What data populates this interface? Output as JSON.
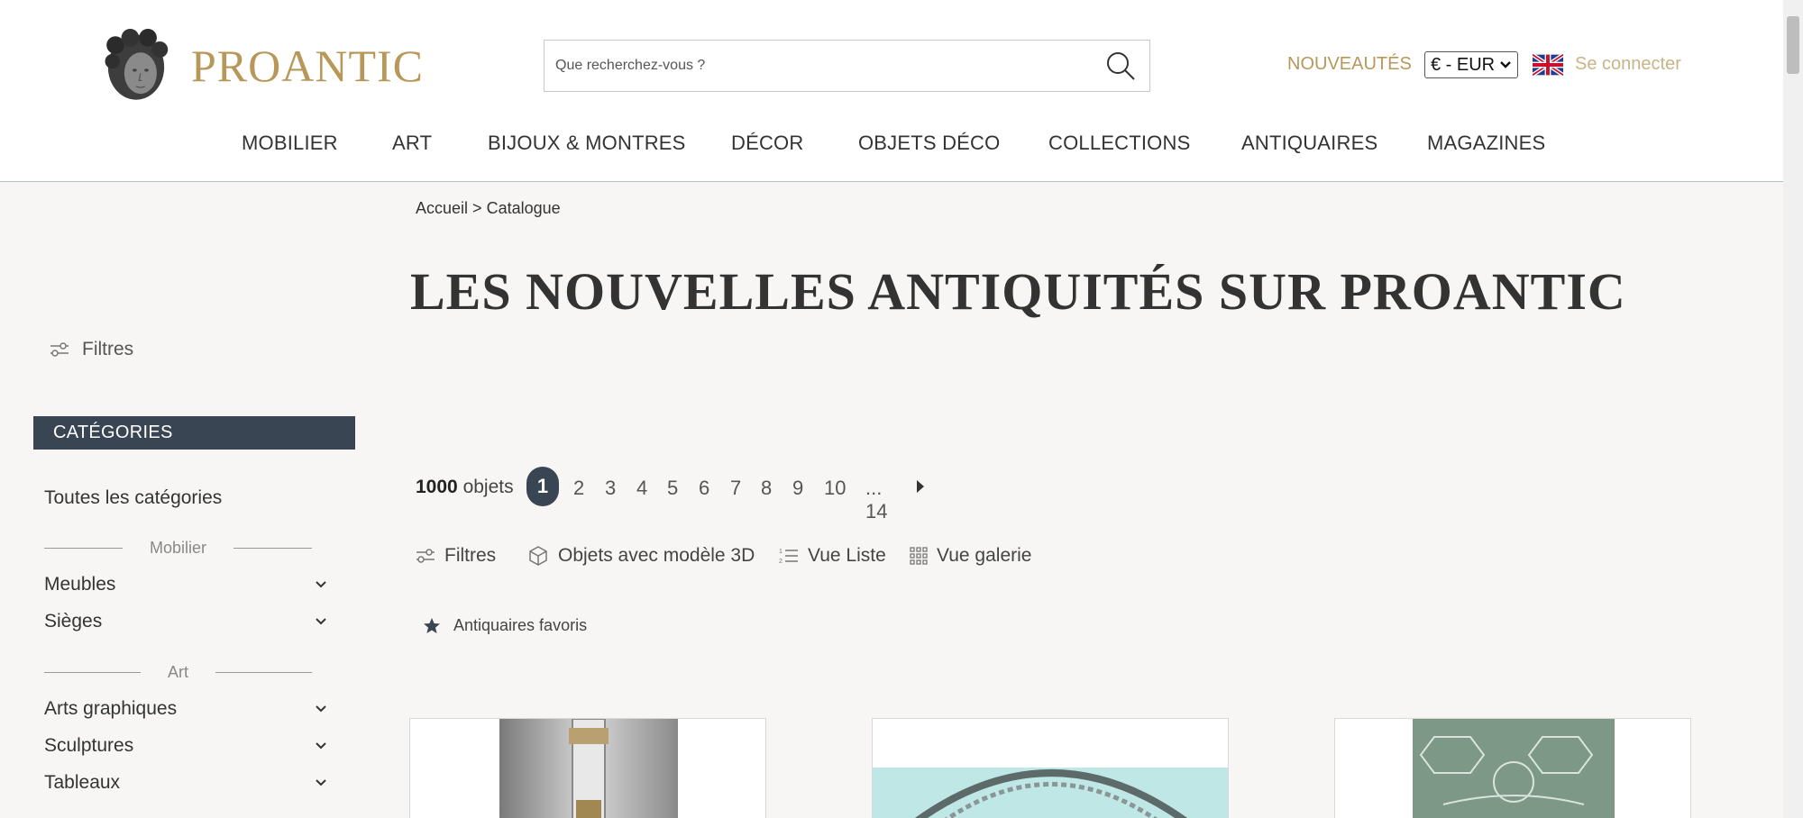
{
  "header": {
    "logo_text": "PROANTIC",
    "search_placeholder": "Que recherchez-vous ?",
    "nouveautes": "NOUVEAUTÉS",
    "currency": "€ - EUR",
    "login": "Se connecter"
  },
  "nav": [
    "MOBILIER",
    "ART",
    "BIJOUX & MONTRES",
    "DÉCOR",
    "OBJETS DÉCO",
    "COLLECTIONS",
    "ANTIQUAIRES",
    "MAGAZINES"
  ],
  "sidebar": {
    "filters": "Filtres",
    "categories_title": "CATÉGORIES",
    "all": "Toutes les catégories",
    "groups": [
      {
        "label": "Mobilier",
        "items": [
          "Meubles",
          "Sièges"
        ]
      },
      {
        "label": "Art",
        "items": [
          "Arts graphiques",
          "Sculptures",
          "Tableaux"
        ]
      }
    ]
  },
  "main": {
    "breadcrumb": {
      "home": "Accueil",
      "sep": ">",
      "current": "Catalogue"
    },
    "title": "LES NOUVELLES ANTIQUITÉS SUR PROANTIC",
    "count_number": "1000",
    "count_label": "objets",
    "pages": [
      "1",
      "2",
      "3",
      "4",
      "5",
      "6",
      "7",
      "8",
      "9",
      "10",
      "... 14"
    ],
    "toolbar": {
      "filters": "Filtres",
      "models3d": "Objets avec modèle 3D",
      "list_view": "Vue Liste",
      "gallery_view": "Vue galerie"
    },
    "favorites": "Antiquaires favoris"
  },
  "colors": {
    "gold": "#b8985a",
    "dark": "#3a4553",
    "bg": "#f7f6f4"
  }
}
